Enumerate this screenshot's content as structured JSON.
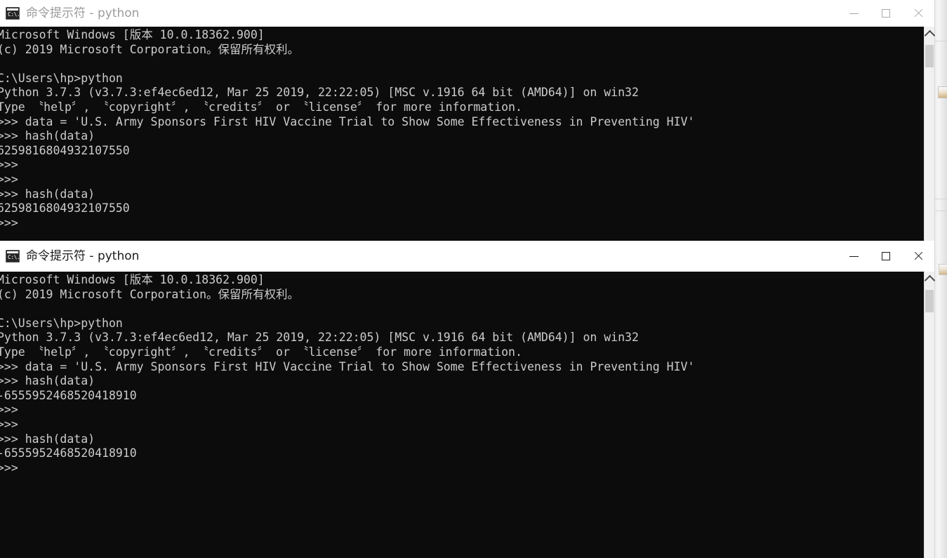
{
  "desktop": {
    "background_color": "#f2f2f2"
  },
  "windows": [
    {
      "id": "window-back",
      "title": "命令提示符 - python",
      "icon": "cmd-icon",
      "icon_text": "C:\\.",
      "active": false,
      "controls": {
        "minimize": "minimize-button",
        "maximize": "maximize-button",
        "close": "close-button"
      },
      "scrollbar": {
        "up_arrow": "scroll-up-arrow"
      },
      "console_text": "Microsoft Windows [版本 10.0.18362.900]\n(c) 2019 Microsoft Corporation。保留所有权利。\n\nC:\\Users\\hp>python\nPython 3.7.3 (v3.7.3:ef4ec6ed12, Mar 25 2019, 22:22:05) [MSC v.1916 64 bit (AMD64)] on win32\nType 〝help〞, 〝copyright〞, 〝credits〞 or 〝license〞 for more information.\n>>> data = 'U.S. Army Sponsors First HIV Vaccine Trial to Show Some Effectiveness in Preventing HIV'\n>>> hash(data)\n6259816804932107550\n>>>\n>>>\n>>> hash(data)\n6259816804932107550\n>>>"
    },
    {
      "id": "window-front",
      "title": "命令提示符 - python",
      "icon": "cmd-icon",
      "icon_text": "C:\\.",
      "active": true,
      "controls": {
        "minimize": "minimize-button",
        "maximize": "maximize-button",
        "close": "close-button"
      },
      "scrollbar": {
        "up_arrow": "scroll-up-arrow"
      },
      "console_text": "Microsoft Windows [版本 10.0.18362.900]\n(c) 2019 Microsoft Corporation。保留所有权利。\n\nC:\\Users\\hp>python\nPython 3.7.3 (v3.7.3:ef4ec6ed12, Mar 25 2019, 22:22:05) [MSC v.1916 64 bit (AMD64)] on win32\nType 〝help〞, 〝copyright〞, 〝credits〞 or 〝license〞 for more information.\n>>> data = 'U.S. Army Sponsors First HIV Vaccine Trial to Show Some Effectiveness in Preventing HIV'\n>>> hash(data)\n-6555952468520418910\n>>>\n>>>\n>>> hash(data)\n-6555952468520418910\n>>>"
    }
  ],
  "colors": {
    "console_background": "#0c0c0c",
    "console_foreground": "#cccccc",
    "titlebar_background": "#ffffff",
    "title_active": "#1a1a1a",
    "title_inactive": "#9b9b9b",
    "scrollbar_track": "#f0f0f0",
    "scrollbar_thumb": "#cdcdcd"
  }
}
